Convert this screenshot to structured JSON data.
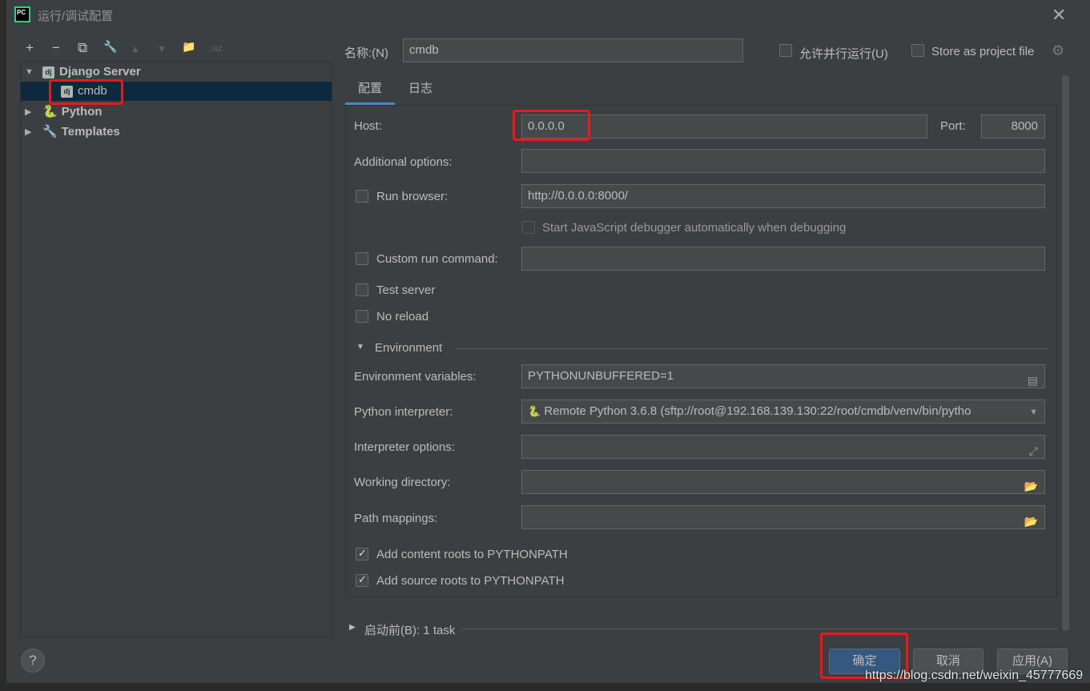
{
  "window": {
    "title": "运行/调试配置",
    "logo": "PC"
  },
  "toolbar": {
    "add": "+",
    "remove": "−",
    "copy": "⧉",
    "edit": "🔧",
    "up": "▲",
    "down": "▼",
    "folder": "📁",
    "sort": "↓az"
  },
  "tree": [
    {
      "label": "Django Server",
      "icon": "dj",
      "expanded": true
    },
    {
      "label": "cmdb",
      "icon": "dj",
      "selected": true
    },
    {
      "label": "Python",
      "icon": "python"
    },
    {
      "label": "Templates",
      "icon": "wrench"
    }
  ],
  "header": {
    "name_label": "名称:(N)",
    "name_value": "cmdb",
    "parallel_label": "允许并行运行(U)",
    "store_label": "Store as project file"
  },
  "tabs": [
    {
      "label": "配置",
      "active": true
    },
    {
      "label": "日志"
    }
  ],
  "form": {
    "host_label": "Host:",
    "host_value": "0.0.0.0",
    "port_label": "Port:",
    "port_value": "8000",
    "additional_label": "Additional options:",
    "additional_value": "",
    "run_browser_label": "Run browser:",
    "run_browser_value": "http://0.0.0.0:8000/",
    "js_debugger_label": "Start JavaScript debugger automatically when debugging",
    "custom_cmd_label": "Custom run command:",
    "test_server_label": "Test server",
    "no_reload_label": "No reload",
    "environment_label": "Environment",
    "env_vars_label": "Environment variables:",
    "env_vars_value": "PYTHONUNBUFFERED=1",
    "interpreter_label": "Python interpreter:",
    "interpreter_value": "Remote Python 3.6.8 (sftp://root@192.168.139.130:22/root/cmdb/venv/bin/pytho",
    "interp_options_label": "Interpreter options:",
    "working_dir_label": "Working directory:",
    "path_mappings_label": "Path mappings:",
    "content_roots_label": "Add content roots to PYTHONPATH",
    "source_roots_label": "Add source roots to PYTHONPATH"
  },
  "before_launch": {
    "label": "启动前(B): 1 task"
  },
  "buttons": {
    "ok": "确定",
    "cancel": "取消",
    "apply": "应用(A)",
    "help": "?"
  },
  "watermark": "https://blog.csdn.net/weixin_45777669"
}
